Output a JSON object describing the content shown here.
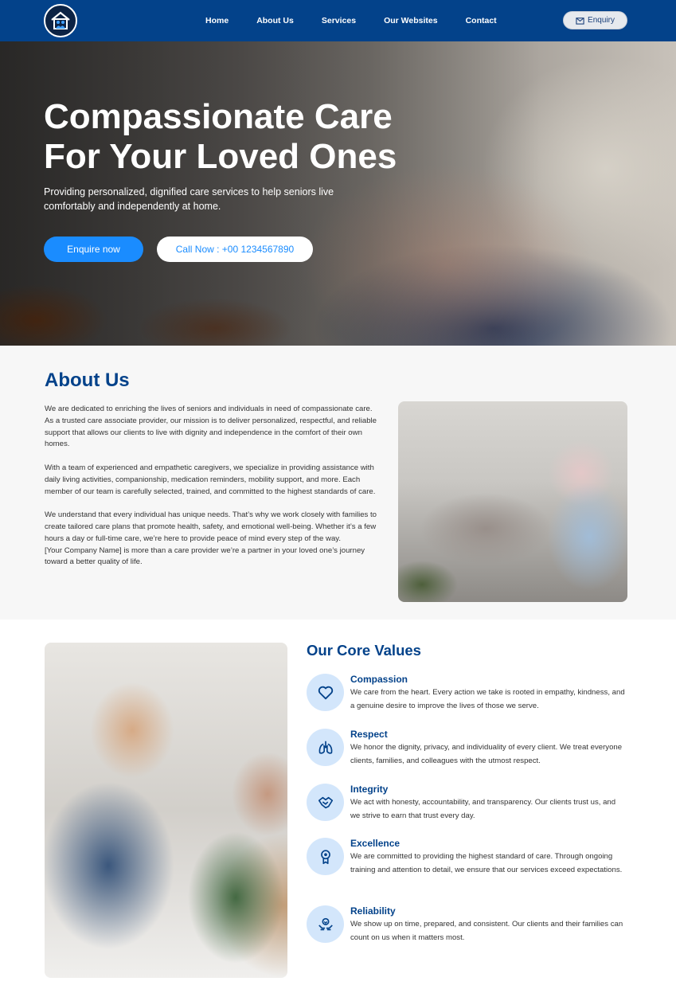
{
  "nav": {
    "links": [
      "Home",
      "About Us",
      "Services",
      "Our Websites",
      "Contact"
    ],
    "enquiry_label": "Enquiry"
  },
  "hero": {
    "title_line1": "Compassionate Care",
    "title_line2": "For Your Loved Ones",
    "subtitle": "Providing personalized, dignified care services to help seniors live comfortably and independently at home.",
    "primary_button": "Enquire now",
    "call_button": "Call Now : +00 1234567890"
  },
  "about": {
    "title": "About Us",
    "paragraphs": [
      "We are dedicated to enriching the lives of seniors and individuals in need of compassionate care. As a trusted care associate provider, our mission is to deliver personalized, respectful, and reliable support that allows our clients to live with dignity and independence in the comfort of their own homes.",
      "With a team of experienced and empathetic caregivers, we specialize in providing assistance with daily living activities, companionship, medication reminders, mobility support, and more. Each member of our team is carefully selected, trained, and committed to the highest standards of care.",
      "We understand that every individual has unique needs. That’s why we work closely with families to create tailored care plans that promote health, safety, and emotional well-being. Whether it’s a few hours a day or full-time care, we’re here to provide peace of mind every step of the way.",
      "[Your Company Name] is more than a care provider we’re a partner in your loved one’s journey toward a better quality of life."
    ]
  },
  "values": {
    "title": "Our Core Values",
    "items": [
      {
        "name": "Compassion",
        "icon": "heart-icon",
        "desc": "We care from the heart. Every action we take is rooted in empathy, kindness, and a genuine desire to improve the lives of those we serve."
      },
      {
        "name": "Respect",
        "icon": "lungs-icon",
        "desc": "We honor the dignity, privacy, and individuality of every client. We treat everyone clients, families, and colleagues  with the utmost respect."
      },
      {
        "name": "Integrity",
        "icon": "handshake-icon",
        "desc": "We act with honesty, accountability, and transparency. Our clients trust us, and we strive to earn that trust every day."
      },
      {
        "name": "Excellence",
        "icon": "award-icon",
        "desc": "We are committed to providing the highest standard of care. Through ongoing training and attention to detail, we ensure that our services exceed expectations."
      },
      {
        "name": "Reliability",
        "icon": "caring-hands-icon",
        "desc": "We show up on time, prepared, and consistent. Our clients and their families can count on us when it matters most."
      }
    ]
  },
  "colors": {
    "brand_blue": "#03428a",
    "accent_blue": "#1a8cff",
    "icon_circle": "#d3e6fb"
  }
}
